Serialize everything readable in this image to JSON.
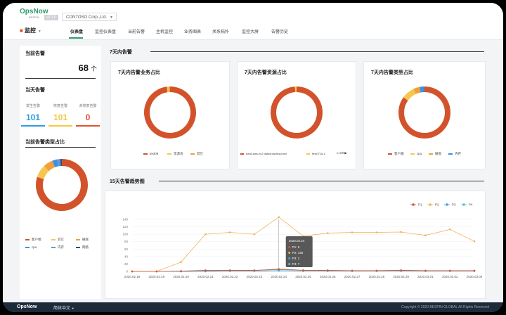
{
  "app": {
    "logo": "OpsNow",
    "logo_sub": "BESPIN",
    "version": "v2.1.0",
    "org": "CONTOSO Corp.,Ltd."
  },
  "nav": {
    "module": "监控",
    "tabs": [
      "仪表盘",
      "监控仪表盘",
      "当前告警",
      "主机监控",
      "业务图表",
      "关系拓扑",
      "监控大屏",
      "告警历史"
    ],
    "active_tab": "仪表盘"
  },
  "left": {
    "current_alerts_title": "当前告警",
    "current_alerts_count": "68",
    "current_alerts_unit": "个",
    "today_title": "当天告警",
    "today_stats": [
      {
        "label": "发生告警",
        "value": "101",
        "color": "#2d9fe0"
      },
      {
        "label": "恢复告警",
        "value": "101",
        "color": "#f5c842"
      },
      {
        "label": "未恢复告警",
        "value": "0",
        "color": "#e0522c"
      }
    ],
    "type_title": "当前告警类型占比",
    "legend": [
      {
        "label": "客户端",
        "color": "#d2532b"
      },
      {
        "label": "其它",
        "color": "#f6c74f"
      },
      {
        "label": "磁盘",
        "color": "#f0a03a"
      },
      {
        "label": "cpu",
        "color": "#3f8fe0"
      },
      {
        "label": "内存",
        "color": "#5a9bd8"
      },
      {
        "label": "网络",
        "color": "#2c4e8c"
      }
    ]
  },
  "section_7d": "7天内告警",
  "section_15d": "15天告警趋势图",
  "donuts": [
    {
      "title": "7天内告警业务占比",
      "slices": [
        {
          "label": "test09",
          "value": 98,
          "color": "#d2532b"
        },
        {
          "label": "资源池",
          "value": 1,
          "color": "#f6c74f"
        },
        {
          "label": "其它",
          "value": 1,
          "color": "#f0a03a"
        }
      ],
      "legend_nav": ""
    },
    {
      "title": "7天内告警资源占比",
      "slices": [
        {
          "label": "bank.aws.ec2.datashowresource",
          "value": 99,
          "color": "#d2532b"
        },
        {
          "label": "test0716-1",
          "value": 1,
          "color": "#f6c74f"
        }
      ],
      "legend_nav": "1/9"
    },
    {
      "title": "7天内告警类型占比",
      "slices": [
        {
          "label": "客户端",
          "value": 85,
          "color": "#d2532b"
        },
        {
          "label": "cpu",
          "value": 8,
          "color": "#f6c74f"
        },
        {
          "label": "磁盘",
          "value": 4,
          "color": "#f0a03a"
        },
        {
          "label": "内存",
          "value": 3,
          "color": "#3f8fe0"
        }
      ],
      "legend_nav": ""
    }
  ],
  "chart_data": {
    "type": "line",
    "x": [
      "2020.02.18",
      "2020.02.19",
      "2020.02.20",
      "2020.02.21",
      "2020.02.22",
      "2020.02.23",
      "2020.02.24",
      "2020.02.25",
      "2020.02.26",
      "2020.02.27",
      "2020.02.28",
      "2020.02.29",
      "2020.03.01",
      "2020.03.02",
      "2020.03.03"
    ],
    "ylim": [
      0,
      140
    ],
    "yticks": [
      0,
      20,
      40,
      60,
      80,
      100,
      120,
      140
    ],
    "series": [
      {
        "name": "P1",
        "color": "#e0522c",
        "values": [
          0,
          0,
          1,
          3,
          3,
          3,
          5,
          3,
          3,
          2,
          2,
          3,
          2,
          2,
          2
        ]
      },
      {
        "name": "P2",
        "color": "#f0b25a",
        "values": [
          0,
          0,
          25,
          100,
          105,
          100,
          146,
          95,
          103,
          105,
          105,
          106,
          97,
          113,
          81
        ]
      },
      {
        "name": "P3",
        "color": "#3fa7e0",
        "values": [
          0,
          0,
          0,
          0,
          1,
          1,
          2,
          1,
          1,
          1,
          1,
          1,
          1,
          1,
          1
        ]
      },
      {
        "name": "P4",
        "color": "#57c0c6",
        "values": [
          0,
          0,
          0,
          1,
          2,
          2,
          7,
          3,
          2,
          2,
          2,
          3,
          2,
          2,
          2
        ]
      }
    ],
    "tooltip": {
      "date": "2020.02.24",
      "lines": [
        "P1: 5",
        "P2: 146",
        "P3: 2",
        "P4: 7"
      ]
    }
  },
  "footer": {
    "logo": "OpsNow",
    "language": "简体中文",
    "copyright": "Copyright © 2020 BESPIN GLOBAL All Rights Reserved"
  }
}
